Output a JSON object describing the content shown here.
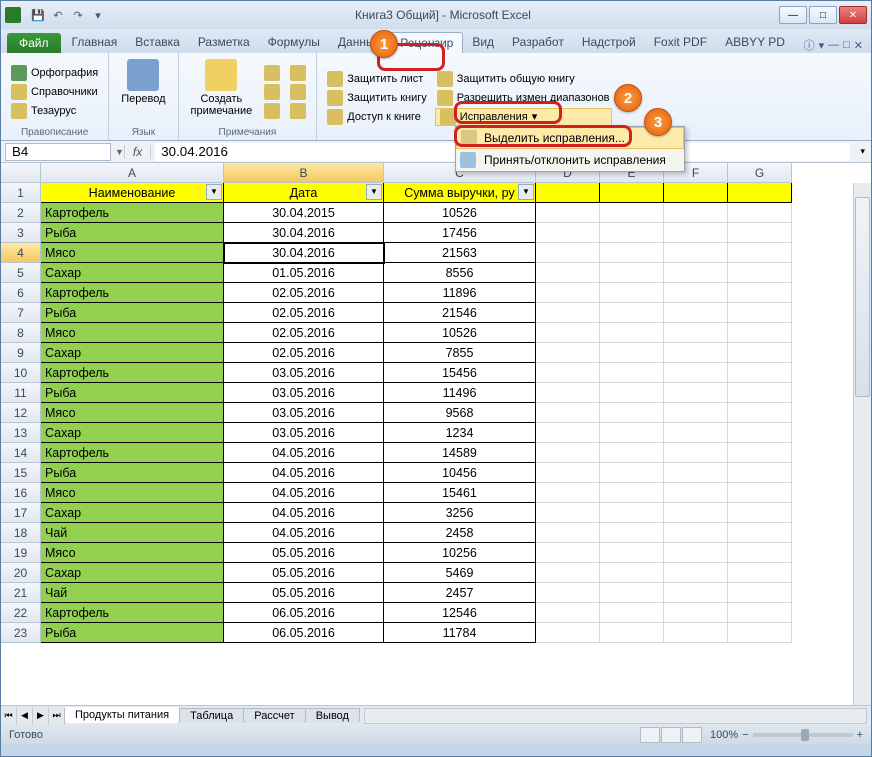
{
  "window": {
    "title": "Книга3         Общий] - Microsoft Excel"
  },
  "qat": {
    "save": "💾",
    "undo": "↶",
    "redo": "↷"
  },
  "winbtns": {
    "min": "—",
    "max": "□",
    "close": "✕"
  },
  "tabs": {
    "file": "Файл",
    "items": [
      "Главная",
      "Вставка",
      "Разметка",
      "Формулы",
      "Данные",
      "Рецензир",
      "Вид",
      "Разработ",
      "Надстрой",
      "Foxit PDF",
      "ABBYY PD"
    ],
    "active_index": 5
  },
  "ribbon": {
    "g1": {
      "label": "Правописание",
      "spelling": "Орфография",
      "reference": "Справочники",
      "thesaurus": "Тезаурус"
    },
    "g2": {
      "label": "Язык",
      "translate": "Перевод"
    },
    "g3": {
      "label": "Примечания",
      "new": "Создать\nпримечание"
    },
    "g4": {
      "protect_sheet": "Защитить лист",
      "protect_book": "Защитить книгу",
      "share_book": "Доступ к книге",
      "protect_shared": "Защитить общую книгу",
      "allow_ranges": "Разрешить измен        диапазонов",
      "track": "Исправления"
    },
    "dropdown": {
      "highlight": "Выделить исправления...",
      "accept": "Принять/отклонить исправления"
    }
  },
  "namebox": "B4",
  "formula": "30.04.2016",
  "columns": [
    "A",
    "B",
    "C",
    "D",
    "E",
    "F",
    "G"
  ],
  "headers": {
    "name": "Наименование",
    "date": "Дата",
    "sum": "Сумма выручки, ру"
  },
  "filter_glyph": "▼",
  "rows": [
    {
      "n": "Картофель",
      "d": "30.04.2015",
      "s": "10526"
    },
    {
      "n": "Рыба",
      "d": "30.04.2016",
      "s": "17456"
    },
    {
      "n": "Мясо",
      "d": "30.04.2016",
      "s": "21563"
    },
    {
      "n": "Сахар",
      "d": "01.05.2016",
      "s": "8556"
    },
    {
      "n": "Картофель",
      "d": "02.05.2016",
      "s": "11896"
    },
    {
      "n": "Рыба",
      "d": "02.05.2016",
      "s": "21546"
    },
    {
      "n": "Мясо",
      "d": "02.05.2016",
      "s": "10526"
    },
    {
      "n": "Сахар",
      "d": "02.05.2016",
      "s": "7855"
    },
    {
      "n": "Картофель",
      "d": "03.05.2016",
      "s": "15456"
    },
    {
      "n": "Рыба",
      "d": "03.05.2016",
      "s": "11496"
    },
    {
      "n": "Мясо",
      "d": "03.05.2016",
      "s": "9568"
    },
    {
      "n": "Сахар",
      "d": "03.05.2016",
      "s": "1234"
    },
    {
      "n": "Картофель",
      "d": "04.05.2016",
      "s": "14589"
    },
    {
      "n": "Рыба",
      "d": "04.05.2016",
      "s": "10456"
    },
    {
      "n": "Мясо",
      "d": "04.05.2016",
      "s": "15461"
    },
    {
      "n": "Сахар",
      "d": "04.05.2016",
      "s": "3256"
    },
    {
      "n": "Чай",
      "d": "04.05.2016",
      "s": "2458"
    },
    {
      "n": "Мясо",
      "d": "05.05.2016",
      "s": "10256"
    },
    {
      "n": "Сахар",
      "d": "05.05.2016",
      "s": "5469"
    },
    {
      "n": "Чай",
      "d": "05.05.2016",
      "s": "2457"
    },
    {
      "n": "Картофель",
      "d": "06.05.2016",
      "s": "12546"
    },
    {
      "n": "Рыба",
      "d": "06.05.2016",
      "s": "11784"
    }
  ],
  "active_row": 4,
  "active_col": "B",
  "sheets": {
    "items": [
      "Продукты питания",
      "Таблица",
      "Рассчет",
      "Вывод"
    ],
    "active": 0
  },
  "status": {
    "ready": "Готово",
    "zoom": "100%"
  },
  "badges": {
    "b1": "1",
    "b2": "2",
    "b3": "3"
  }
}
